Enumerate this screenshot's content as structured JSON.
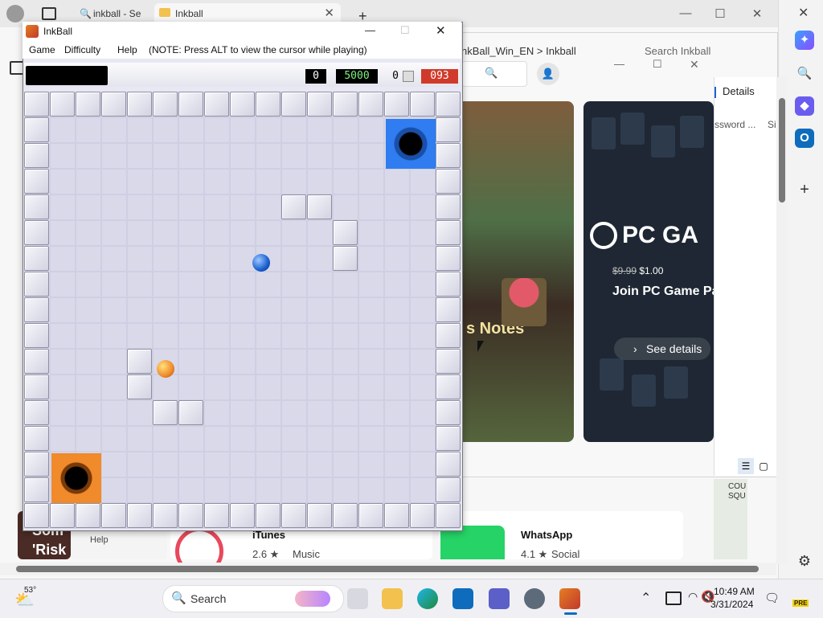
{
  "browser": {
    "tab1_label": "inkball - Se",
    "tab2_label": "Inkball"
  },
  "store": {
    "breadcrumb": "nkBall_Win_EN  >  Inkball",
    "search_placeholder": "Search Inkball",
    "details_tab": "Details",
    "password_text": "ssword ...",
    "si_text": "Si",
    "card1_banner": "s Notes",
    "card2_logo": "PC GA",
    "price_old": "$9.99",
    "price_new": "$1.00",
    "join_text": "Join PC Game Pa",
    "see_details": "See details",
    "apps": [
      {
        "name": "iTunes",
        "rating": "2.6 ★",
        "category": "Music"
      },
      {
        "name": "WhatsApp",
        "rating": "4.1 ★",
        "category": "Social"
      }
    ],
    "left_text": "Som 'Risk",
    "help_text": "Help",
    "map_text": "COU SQU"
  },
  "inkball": {
    "title": "InkBall",
    "menu": [
      "Game",
      "Difficulty",
      "Help"
    ],
    "note": "(NOTE: Press ALT to view the cursor while playing)",
    "score": "0",
    "target": "5000",
    "balls_left": "0",
    "timer": "093"
  },
  "taskbar": {
    "weather_temp": "53°",
    "search_label": "Search",
    "time": "10:49 AM",
    "date": "3/31/2024",
    "pre_badge": "PRE"
  },
  "colors": {
    "blue_hole": "#2f7df0",
    "orange_hole": "#f08a2a",
    "timer_bg": "#d03a2a",
    "target_fg": "#7ef07e"
  }
}
